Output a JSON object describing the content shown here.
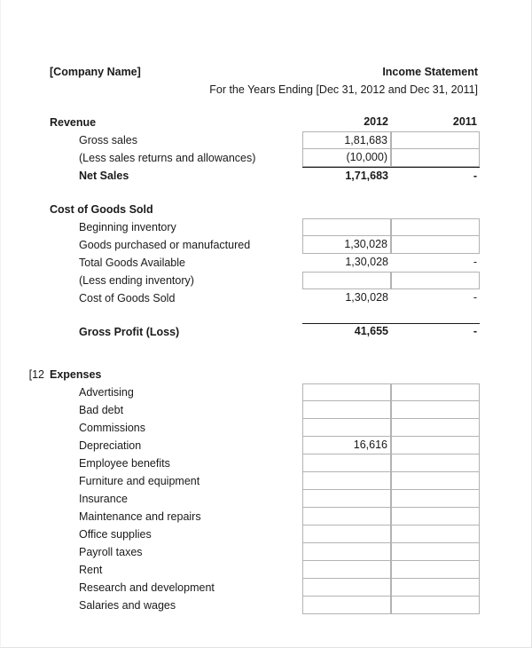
{
  "header": {
    "company": "[Company Name]",
    "title": "Income Statement",
    "subtitle": "For the Years Ending [Dec 31, 2012 and Dec 31, 2011]"
  },
  "columns": {
    "year_2012": "2012",
    "year_2011": "2011"
  },
  "margin_note": "12]",
  "sections": {
    "revenue": {
      "heading": "Revenue",
      "rows": [
        {
          "label": "Gross sales",
          "v2012": "1,81,683",
          "v2011": ""
        },
        {
          "label": "(Less sales returns and allowances)",
          "v2012": "(10,000)",
          "v2011": ""
        },
        {
          "label": "Net Sales",
          "v2012": "1,71,683",
          "v2011": "-"
        }
      ]
    },
    "cogs": {
      "heading": "Cost of Goods Sold",
      "rows": [
        {
          "label": "Beginning inventory",
          "v2012": "",
          "v2011": ""
        },
        {
          "label": "Goods purchased or manufactured",
          "v2012": "1,30,028",
          "v2011": ""
        },
        {
          "label": "Total Goods Available",
          "v2012": "1,30,028",
          "v2011": "-"
        },
        {
          "label": "(Less ending inventory)",
          "v2012": "",
          "v2011": ""
        },
        {
          "label": "Cost of Goods Sold",
          "v2012": "1,30,028",
          "v2011": "-"
        }
      ]
    },
    "gross_profit": {
      "label": "Gross Profit (Loss)",
      "v2012": "41,655",
      "v2011": "-"
    },
    "expenses": {
      "heading": "Expenses",
      "rows": [
        {
          "label": "Advertising",
          "v2012": "",
          "v2011": ""
        },
        {
          "label": "Bad debt",
          "v2012": "",
          "v2011": ""
        },
        {
          "label": "Commissions",
          "v2012": "",
          "v2011": ""
        },
        {
          "label": "Depreciation",
          "v2012": "16,616",
          "v2011": ""
        },
        {
          "label": "Employee benefits",
          "v2012": "",
          "v2011": ""
        },
        {
          "label": "Furniture and equipment",
          "v2012": "",
          "v2011": ""
        },
        {
          "label": "Insurance",
          "v2012": "",
          "v2011": ""
        },
        {
          "label": "Maintenance and repairs",
          "v2012": "",
          "v2011": ""
        },
        {
          "label": "Office supplies",
          "v2012": "",
          "v2011": ""
        },
        {
          "label": "Payroll taxes",
          "v2012": "",
          "v2011": ""
        },
        {
          "label": "Rent",
          "v2012": "",
          "v2011": ""
        },
        {
          "label": "Research and development",
          "v2012": "",
          "v2011": ""
        },
        {
          "label": "Salaries and wages",
          "v2012": "",
          "v2011": ""
        }
      ]
    }
  }
}
